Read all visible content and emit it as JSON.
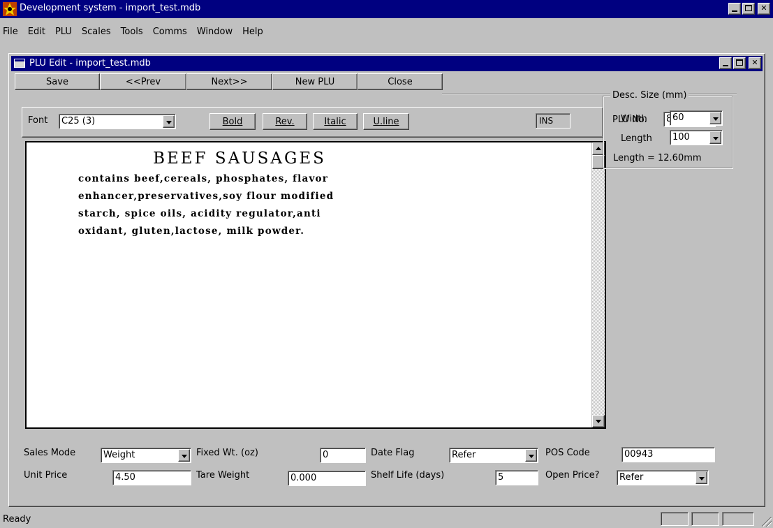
{
  "window": {
    "title": "Development system - import_test.mdb"
  },
  "menu": {
    "items": [
      {
        "label": "File"
      },
      {
        "label": "Edit"
      },
      {
        "label": "PLU"
      },
      {
        "label": "Scales"
      },
      {
        "label": "Tools"
      },
      {
        "label": "Comms"
      },
      {
        "label": "Window"
      },
      {
        "label": "Help"
      }
    ]
  },
  "child": {
    "title": "PLU Edit - import_test.mdb"
  },
  "toolbar": {
    "save": "Save",
    "prev": "<<Prev",
    "next": "Next>>",
    "new_plu": "New PLU",
    "close": "Close"
  },
  "font_bar": {
    "font_label": "Font",
    "font_value": "C25 (3)",
    "bold": "Bold",
    "rev": "Rev.",
    "italic": "Italic",
    "uline": "U.line",
    "mode": "INS"
  },
  "description": {
    "title": "BEEF  SAUSAGES",
    "lines": [
      "contains beef,cereals, phosphates, flavor",
      "enhancer,preservatives,soy flour modified",
      "starch, spice oils, acidity regulator,anti",
      "oxidant, gluten,lactose, milk powder."
    ]
  },
  "plu": {
    "label": "PLU No.",
    "value": "801"
  },
  "desc_size": {
    "legend": "Desc. Size (mm)",
    "width_label": "Width",
    "width_value": "60",
    "length_label": "Length",
    "length_value": "100",
    "computed": "Length = 12.60mm"
  },
  "fields": {
    "sales_mode_label": "Sales Mode",
    "sales_mode_value": "Weight",
    "fixed_wt_label": "Fixed Wt. (oz)",
    "fixed_wt_value": "0",
    "date_flag_label": "Date Flag",
    "date_flag_value": "Refer",
    "pos_code_label": "POS Code",
    "pos_code_value": "00943",
    "unit_price_label": "Unit Price",
    "unit_price_value": "4.50",
    "tare_weight_label": "Tare Weight",
    "tare_weight_value": "0.000",
    "shelf_life_label": "Shelf Life (days)",
    "shelf_life_value": "5",
    "open_price_label": "Open Price?",
    "open_price_value": "Refer"
  },
  "status": {
    "text": "Ready"
  },
  "colors": {
    "titlebar": "#000080",
    "face": "#c0c0c0"
  }
}
